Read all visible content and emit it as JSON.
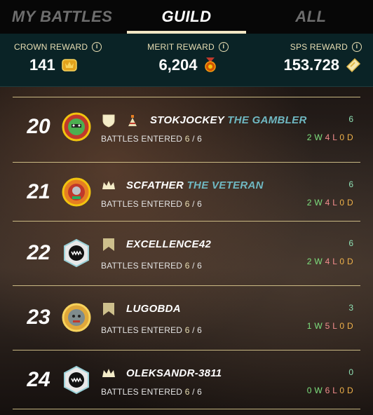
{
  "tabs": [
    {
      "label": "MY BATTLES",
      "active": false
    },
    {
      "label": "GUILD",
      "active": true
    },
    {
      "label": "ALL",
      "active": false
    }
  ],
  "rewards": [
    {
      "label": "CROWN REWARD",
      "value": "141",
      "icon": "crown-token-icon"
    },
    {
      "label": "MERIT REWARD",
      "value": "6,204",
      "icon": "merit-medal-icon"
    },
    {
      "label": "SPS REWARD",
      "value": "153.728",
      "icon": "sps-token-icon"
    }
  ],
  "info_symbol": "i",
  "entered_label": "BATTLES ENTERED",
  "rows": [
    {
      "rank": "20",
      "name": "STOKJOCKEY",
      "title": "THE GAMBLER",
      "status": "shield",
      "entered": "6",
      "total": "6",
      "score": "6",
      "wins": "2",
      "losses": "4",
      "draws": "0"
    },
    {
      "rank": "21",
      "name": "SCFATHER",
      "title": "THE VETERAN",
      "status": "crown",
      "entered": "6",
      "total": "6",
      "score": "6",
      "wins": "2",
      "losses": "4",
      "draws": "0"
    },
    {
      "rank": "22",
      "name": "EXCELLENCE42",
      "title": "",
      "status": "banner",
      "entered": "6",
      "total": "6",
      "score": "6",
      "wins": "2",
      "losses": "4",
      "draws": "0"
    },
    {
      "rank": "23",
      "name": "LUGOBDA",
      "title": "",
      "status": "banner",
      "entered": "6",
      "total": "6",
      "score": "3",
      "wins": "1",
      "losses": "5",
      "draws": "0"
    },
    {
      "rank": "24",
      "name": "OLEKSANDR-3811",
      "title": "",
      "status": "crown",
      "entered": "6",
      "total": "6",
      "score": "0",
      "wins": "0",
      "losses": "6",
      "draws": "0"
    }
  ],
  "wld_letters": {
    "w": "W",
    "l": "L",
    "d": "D"
  },
  "colors": {
    "accent": "#e9dfb4",
    "title": "#6fb8c2",
    "win": "#7ee07e",
    "loss": "#f28d8d",
    "draw": "#f0b24a",
    "reward_bg": "#0a2326"
  }
}
